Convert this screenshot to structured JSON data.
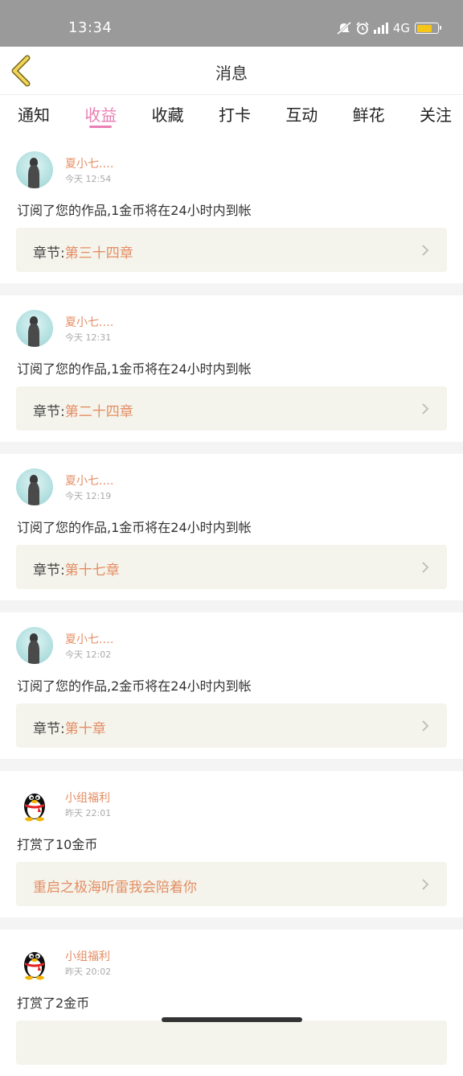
{
  "status_bar": {
    "time": "13:34",
    "network": "4G",
    "icons": [
      "mute-icon",
      "alarm-icon",
      "signal-icon",
      "battery-icon"
    ],
    "battery_color": "#f5c518"
  },
  "header": {
    "title": "消息",
    "back_icon": "chevron-left-icon"
  },
  "tabs": [
    {
      "label": "通知",
      "active": false
    },
    {
      "label": "收益",
      "active": true
    },
    {
      "label": "收藏",
      "active": false
    },
    {
      "label": "打卡",
      "active": false
    },
    {
      "label": "互动",
      "active": false
    },
    {
      "label": "鲜花",
      "active": false
    },
    {
      "label": "关注",
      "active": false
    }
  ],
  "accent_color": "#e97fb2",
  "name_color": "#e48d63",
  "messages": [
    {
      "user": "夏小七.…",
      "time": "今天  12:54",
      "text": "订阅了您的作品,1金币将在24小时内到帐",
      "chapter_prefix": "章节:",
      "chapter": "第三十四章",
      "avatar": "photo"
    },
    {
      "user": "夏小七.…",
      "time": "今天  12:31",
      "text": "订阅了您的作品,1金币将在24小时内到帐",
      "chapter_prefix": "章节:",
      "chapter": "第二十四章",
      "avatar": "photo"
    },
    {
      "user": "夏小七.…",
      "time": "今天  12:19",
      "text": "订阅了您的作品,1金币将在24小时内到帐",
      "chapter_prefix": "章节:",
      "chapter": "第十七章",
      "avatar": "photo"
    },
    {
      "user": "夏小七.…",
      "time": "今天  12:02",
      "text": "订阅了您的作品,2金币将在24小时内到帐",
      "chapter_prefix": "章节:",
      "chapter": "第十章",
      "avatar": "photo"
    },
    {
      "user": "小组福利",
      "time": "昨天  22:01",
      "text": "打赏了10金币",
      "chapter_prefix": "",
      "chapter": "重启之极海听雷我会陪着你",
      "avatar": "qq"
    },
    {
      "user": "小组福利",
      "time": "昨天  20:02",
      "text": "打赏了2金币",
      "chapter_prefix": "",
      "chapter": "",
      "avatar": "qq"
    }
  ]
}
